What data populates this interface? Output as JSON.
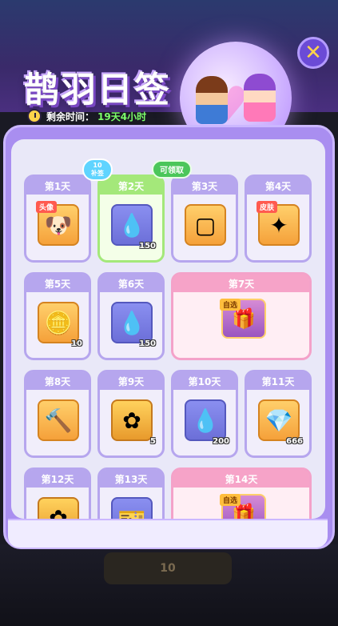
{
  "header": {
    "title": "鹊羽日签",
    "time_label": "剩余时间：",
    "time_value": "19天4小时",
    "close_icon": "close-icon"
  },
  "badges": {
    "bubble_top": "10",
    "bubble_bottom": "补签",
    "claimable": "可领取"
  },
  "days": [
    {
      "label": "第1天",
      "icon": "avatar-frame-dog",
      "tag": "头像",
      "qty": ""
    },
    {
      "label": "第2天",
      "icon": "water-drop",
      "tag": "",
      "qty": "150"
    },
    {
      "label": "第3天",
      "icon": "pink-frame",
      "tag": "",
      "qty": ""
    },
    {
      "label": "第4天",
      "icon": "magic-wand",
      "tag": "皮肤",
      "qty": ""
    },
    {
      "label": "第5天",
      "icon": "gold-token",
      "tag": "",
      "qty": "10"
    },
    {
      "label": "第6天",
      "icon": "water-drop",
      "tag": "",
      "qty": "150"
    },
    {
      "label": "第7天",
      "icon": "treasure-chest",
      "tag": "自选",
      "qty": ""
    },
    {
      "label": "第8天",
      "icon": "hammer",
      "tag": "",
      "qty": ""
    },
    {
      "label": "第9天",
      "icon": "gold-coin",
      "tag": "",
      "qty": "5"
    },
    {
      "label": "第10天",
      "icon": "water-drop",
      "tag": "",
      "qty": "200"
    },
    {
      "label": "第11天",
      "icon": "diamond",
      "tag": "",
      "qty": "666"
    },
    {
      "label": "第12天",
      "icon": "gold-coin",
      "tag": "",
      "qty": ""
    },
    {
      "label": "第13天",
      "icon": "ticket",
      "tag": "",
      "qty": ""
    },
    {
      "label": "第14天",
      "icon": "treasure-chest",
      "tag": "自选",
      "qty": ""
    }
  ],
  "bottom_button": "10",
  "colors": {
    "accent": "#a98ef0",
    "claimable": "#4bc65a",
    "special": "#f6a3c8"
  }
}
